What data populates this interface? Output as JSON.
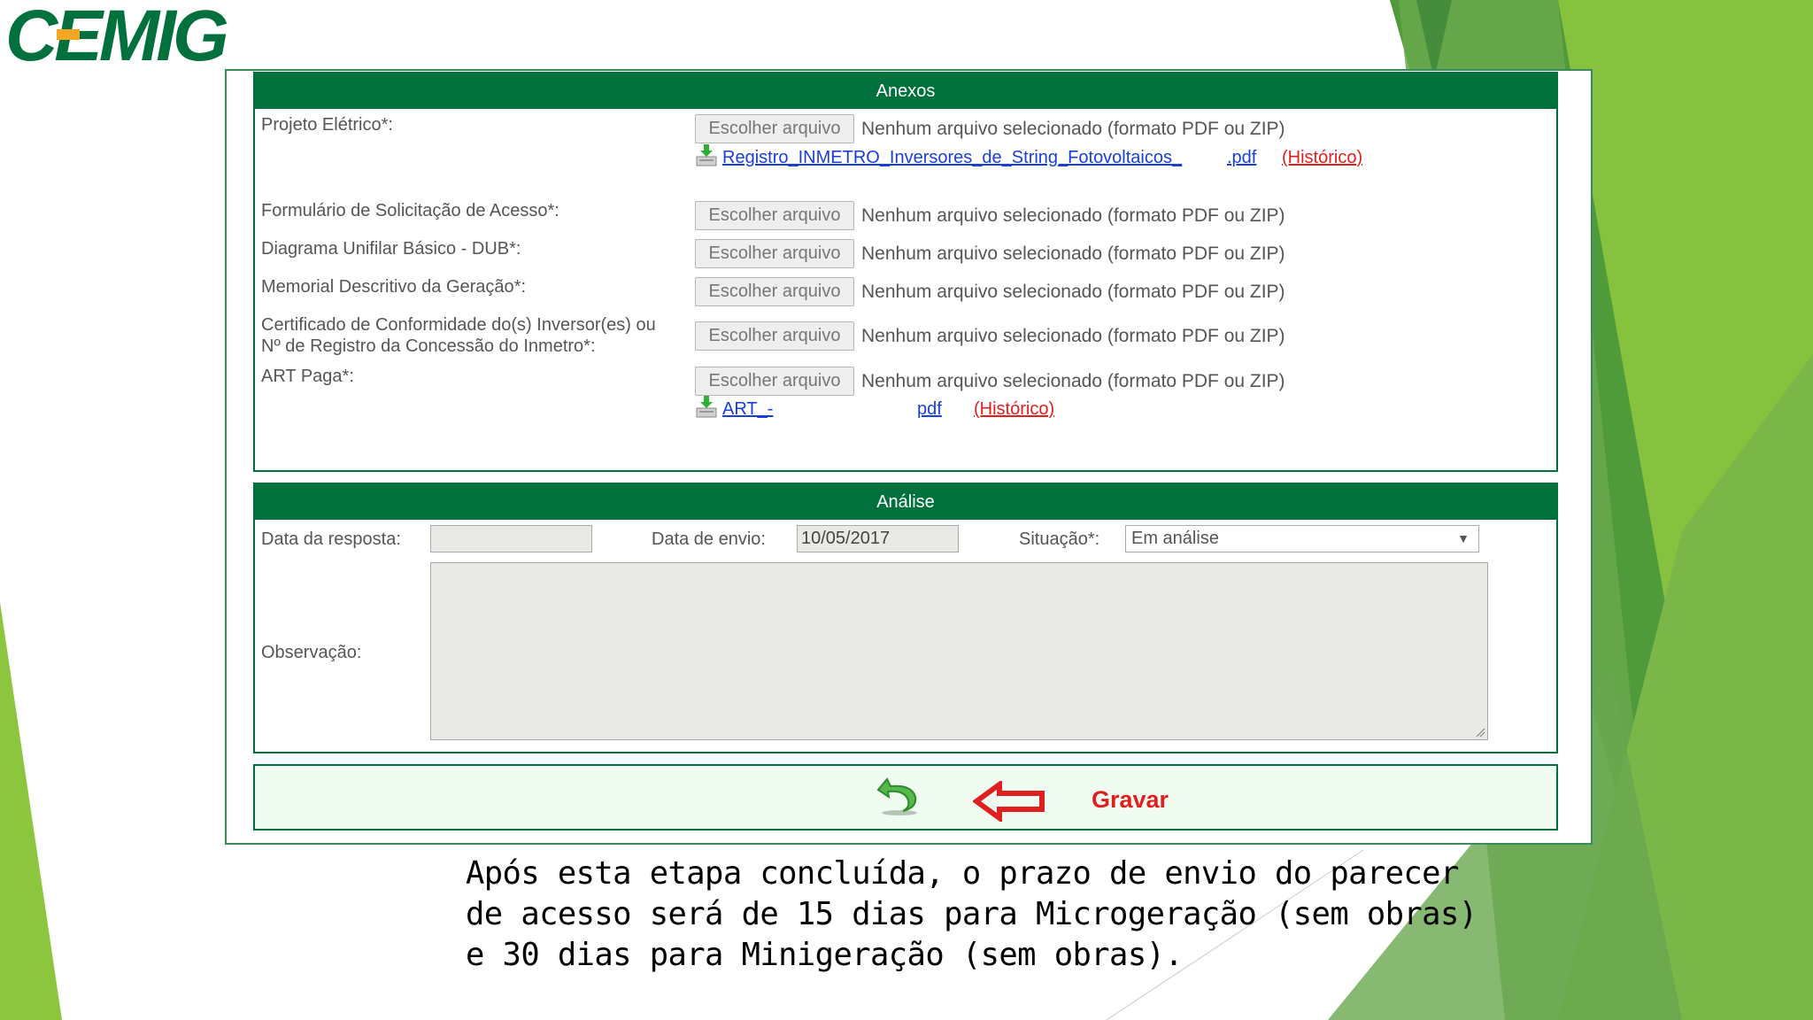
{
  "brand": {
    "logo_text": "CEMIG",
    "color": "#00703c"
  },
  "anexos": {
    "title": "Anexos",
    "file_button_label": "Escolher arquivo",
    "no_file_text": "Nenhum arquivo selecionado (formato PDF ou ZIP)",
    "fields": [
      {
        "label": "Projeto Elétrico*:"
      },
      {
        "label": "Formulário de Solicitação de Acesso*:"
      },
      {
        "label": "Diagrama Unifilar Básico - DUB*:"
      },
      {
        "label": "Memorial Descritivo da Geração*:"
      },
      {
        "label_line1": "Certificado de Conformidade do(s) Inversor(es) ou",
        "label_line2": "Nº de Registro da Concessão do Inmetro*:"
      },
      {
        "label": "ART Paga*:"
      }
    ],
    "attachments": {
      "projeto": {
        "name": "Registro_INMETRO_Inversores_de_String_Fotovoltaicos_",
        "ext": ".pdf",
        "history": "(Histórico)"
      },
      "art": {
        "name": "ART_-",
        "ext": "pdf",
        "history": "(Histórico)"
      }
    }
  },
  "analise": {
    "title": "Análise",
    "data_resposta_label": "Data da resposta:",
    "data_resposta_value": "",
    "data_envio_label": "Data de envio:",
    "data_envio_value": "10/05/2017",
    "situacao_label": "Situação*:",
    "situacao_value": "Em análise",
    "observacao_label": "Observação:"
  },
  "actions": {
    "back_icon": "undo-arrow-icon",
    "pointer_icon": "red-left-arrow-icon",
    "annotation": "Gravar"
  },
  "caption": {
    "line1": "Após esta etapa concluída, o prazo de envio do parecer",
    "line2": "de acesso será de 15 dias para Microgeração (sem obras)",
    "line3": "e 30 dias para Minigeração (sem obras)."
  }
}
